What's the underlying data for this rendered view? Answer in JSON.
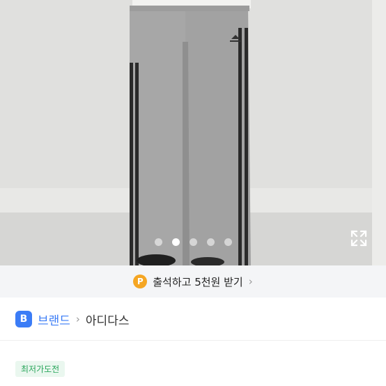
{
  "image": {
    "alt": "grey wide leg track pants with black side stripes"
  },
  "carousel": {
    "total": 5,
    "active_index": 1
  },
  "attendance": {
    "badge": "P",
    "text": "출석하고 5천원 받기",
    "chevron": "›"
  },
  "brand": {
    "badge": "B",
    "label": "브랜드",
    "separator": "›",
    "name": "아디다스"
  },
  "tag": {
    "label": "최저가도전"
  },
  "colors": {
    "brand_blue": "#3b7cf6",
    "badge_orange": "#f5a623",
    "tag_green": "#2aa65b"
  }
}
